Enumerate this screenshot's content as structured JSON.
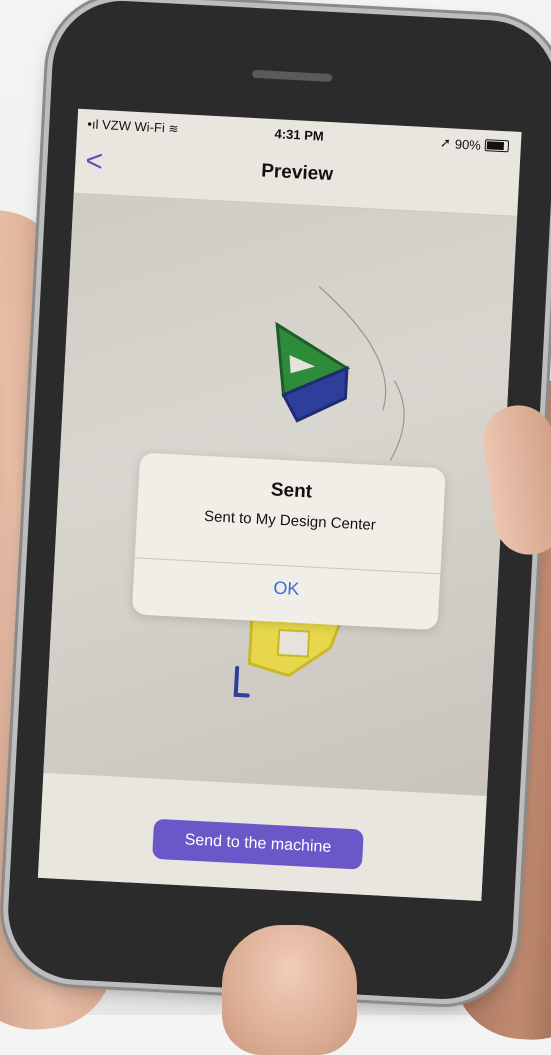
{
  "status_bar": {
    "carrier": "VZW Wi-Fi",
    "time": "4:31 PM",
    "battery": "90%"
  },
  "nav": {
    "back_glyph": "<",
    "title": "Preview"
  },
  "alert": {
    "title": "Sent",
    "message": "Sent to My Design Center",
    "ok_label": "OK"
  },
  "bottom": {
    "send_label": "Send to the machine"
  },
  "colors": {
    "accent": "#6a58c9",
    "alert_button": "#3a6ed6"
  },
  "icons": [
    "signal-icon",
    "wifi-icon",
    "location-icon",
    "battery-icon",
    "chevron-left-icon"
  ]
}
